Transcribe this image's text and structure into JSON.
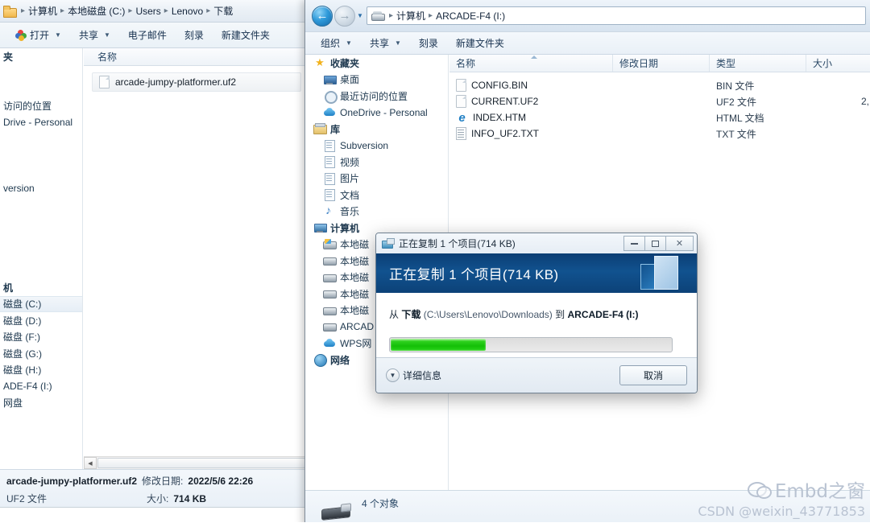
{
  "background_window": {
    "breadcrumb": {
      "icon": "folder-icon",
      "items": [
        "计算机",
        "本地磁盘 (C:)",
        "Users",
        "Lenovo",
        "下载"
      ],
      "separator": "▸"
    },
    "toolbar": [
      {
        "label": "打开",
        "has_caret": true,
        "icon": "open-with-icon"
      },
      {
        "label": "共享",
        "has_caret": true
      },
      {
        "label": "电子邮件",
        "has_caret": false
      },
      {
        "label": "刻录",
        "has_caret": false
      },
      {
        "label": "新建文件夹",
        "has_caret": false
      }
    ],
    "nav_items": [
      {
        "label": "夹",
        "selected": false,
        "head": true
      },
      {
        "label": "",
        "selected": false
      },
      {
        "label": "",
        "selected": false
      },
      {
        "label": "访问的位置",
        "selected": false
      },
      {
        "label": "Drive - Personal",
        "selected": false
      },
      {
        "label": "",
        "selected": false
      },
      {
        "label": "",
        "selected": false
      },
      {
        "label": "",
        "selected": false
      },
      {
        "label": "version",
        "selected": false
      },
      {
        "label": "",
        "selected": false
      },
      {
        "label": "",
        "selected": false
      },
      {
        "label": "",
        "selected": false
      },
      {
        "label": "",
        "selected": false
      },
      {
        "label": "",
        "selected": false
      },
      {
        "label": "机",
        "selected": false,
        "head": true
      },
      {
        "label": "磁盘 (C:)",
        "selected": true
      },
      {
        "label": "磁盘 (D:)",
        "selected": false
      },
      {
        "label": "磁盘 (F:)",
        "selected": false
      },
      {
        "label": "磁盘 (G:)",
        "selected": false
      },
      {
        "label": "磁盘 (H:)",
        "selected": false
      },
      {
        "label": "ADE-F4 (I:)",
        "selected": false
      },
      {
        "label": "网盘",
        "selected": false
      }
    ],
    "column_header": "名称",
    "file_row": {
      "name": "arcade-jumpy-platformer.uf2",
      "icon": "file-icon"
    },
    "status": {
      "name": "arcade-jumpy-platformer.uf2",
      "modified_label": "修改日期:",
      "modified_value": "2022/5/6 22:26",
      "type": "UF2 文件",
      "size_label": "大小:",
      "size_value": "714 KB"
    }
  },
  "foreground_window": {
    "nav": {
      "back_glyph": "←",
      "forward_glyph": "→",
      "dropdown_glyph": "▼",
      "address_icon": "drive-icon",
      "breadcrumb": [
        "计算机",
        "ARCADE-F4 (I:)"
      ],
      "separator": "▸"
    },
    "toolbar": [
      {
        "label": "组织",
        "has_caret": true
      },
      {
        "label": "共享",
        "has_caret": true
      },
      {
        "label": "刻录",
        "has_caret": false
      },
      {
        "label": "新建文件夹",
        "has_caret": false
      }
    ],
    "nav_tree": [
      {
        "label": "收藏夹",
        "icon": "star-icon",
        "level": 1,
        "head": true
      },
      {
        "label": "桌面",
        "icon": "desktop-icon",
        "level": 2
      },
      {
        "label": "最近访问的位置",
        "icon": "recent-places-icon",
        "level": 2
      },
      {
        "label": "OneDrive - Personal",
        "icon": "cloud-icon",
        "level": 2
      },
      {
        "label": "库",
        "icon": "library-icon",
        "level": 1,
        "head": true
      },
      {
        "label": "Subversion",
        "icon": "document-icon",
        "level": 2
      },
      {
        "label": "视频",
        "icon": "document-icon",
        "level": 2
      },
      {
        "label": "图片",
        "icon": "document-icon",
        "level": 2
      },
      {
        "label": "文档",
        "icon": "document-icon",
        "level": 2
      },
      {
        "label": "音乐",
        "icon": "music-icon",
        "level": 2
      },
      {
        "label": "计算机",
        "icon": "computer-icon",
        "level": 1,
        "head": true
      },
      {
        "label": "本地磁",
        "icon": "hdd-windows-icon",
        "level": 2
      },
      {
        "label": "本地磁",
        "icon": "hdd-icon",
        "level": 2
      },
      {
        "label": "本地磁",
        "icon": "hdd-icon",
        "level": 2
      },
      {
        "label": "本地磁",
        "icon": "hdd-icon",
        "level": 2
      },
      {
        "label": "本地磁",
        "icon": "hdd-icon",
        "level": 2
      },
      {
        "label": "ARCAD",
        "icon": "usb-drive-icon",
        "level": 2
      },
      {
        "label": "WPS网",
        "icon": "cloud-icon",
        "level": 2
      },
      {
        "label": "网络",
        "icon": "network-icon",
        "level": 1,
        "head": true
      }
    ],
    "columns": [
      {
        "label": "名称",
        "sorted": true
      },
      {
        "label": "修改日期",
        "sorted": false
      },
      {
        "label": "类型",
        "sorted": false
      },
      {
        "label": "大小",
        "sorted": false
      }
    ],
    "files": [
      {
        "name": "CONFIG.BIN",
        "icon": "file-icon",
        "modified": "",
        "type": "BIN 文件",
        "size": ""
      },
      {
        "name": "CURRENT.UF2",
        "icon": "file-icon",
        "modified": "",
        "type": "UF2 文件",
        "size": "2,"
      },
      {
        "name": "INDEX.HTM",
        "icon": "internet-explorer-icon",
        "modified": "",
        "type": "HTML 文档",
        "size": ""
      },
      {
        "name": "INFO_UF2.TXT",
        "icon": "text-file-icon",
        "modified": "",
        "type": "TXT 文件",
        "size": ""
      }
    ],
    "status": {
      "icon": "usb-drive-icon",
      "text": "4 个对象"
    }
  },
  "copy_dialog": {
    "titlebar": {
      "icon": "copy-icon",
      "title": "正在复制 1 个项目(714 KB)",
      "minimize": "minimize-button",
      "maximize": "maximize-button",
      "close": "✕"
    },
    "header_title": "正在复制 1 个项目(714 KB)",
    "path": {
      "from_label": "从",
      "source_name": "下载",
      "source_path": "(C:\\Users\\Lenovo\\Downloads)",
      "to_label": "到",
      "destination": "ARCADE-F4 (I:)"
    },
    "progress": {
      "percent": 34,
      "fill_color": "#22cc14"
    },
    "details_button": {
      "label": "详细信息",
      "icon": "chevron-down-icon"
    },
    "cancel_button": "取消"
  },
  "watermark": {
    "icon": "wechat-icon",
    "line1": "Embd之窗",
    "line2": "CSDN @weixin_43771853"
  }
}
